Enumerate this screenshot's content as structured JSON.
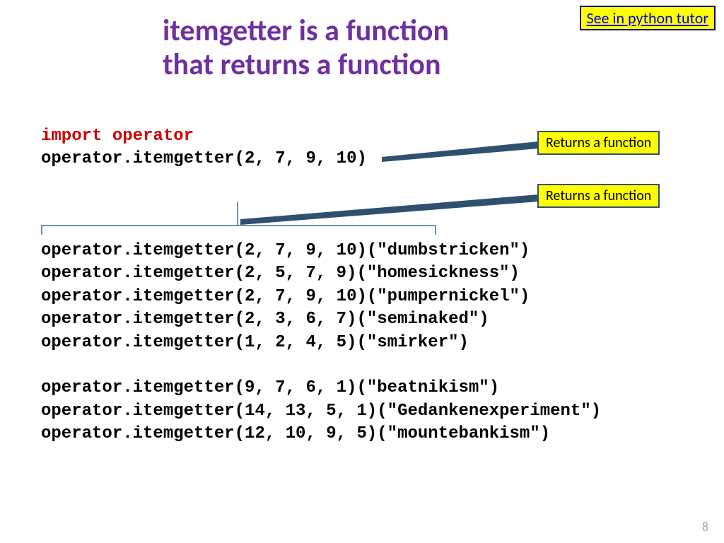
{
  "title": {
    "line1": "itemgetter is a function",
    "line2": "that returns a function"
  },
  "link": {
    "label": "See in python tutor"
  },
  "callouts": {
    "c1": "Returns a function",
    "c2": "Returns a function"
  },
  "code": {
    "import_line": "import operator",
    "l1": "operator.itemgetter(2, 7, 9, 10)",
    "blank1": "",
    "blank2": "",
    "blank3": "",
    "l2": "operator.itemgetter(2, 7, 9, 10)(\"dumbstricken\")",
    "l3": "operator.itemgetter(2, 5, 7, 9)(\"homesickness\")",
    "l4": "operator.itemgetter(2, 7, 9, 10)(\"pumpernickel\")",
    "l5": "operator.itemgetter(2, 3, 6, 7)(\"seminaked\")",
    "l6": "operator.itemgetter(1, 2, 4, 5)(\"smirker\")",
    "blank4": "",
    "l7": "operator.itemgetter(9, 7, 6, 1)(\"beatnikism\")",
    "l8": "operator.itemgetter(14, 13, 5, 1)(\"Gedankenexperiment\")",
    "l9": "operator.itemgetter(12, 10, 9, 5)(\"mountebankism\")"
  },
  "page_number": "8"
}
